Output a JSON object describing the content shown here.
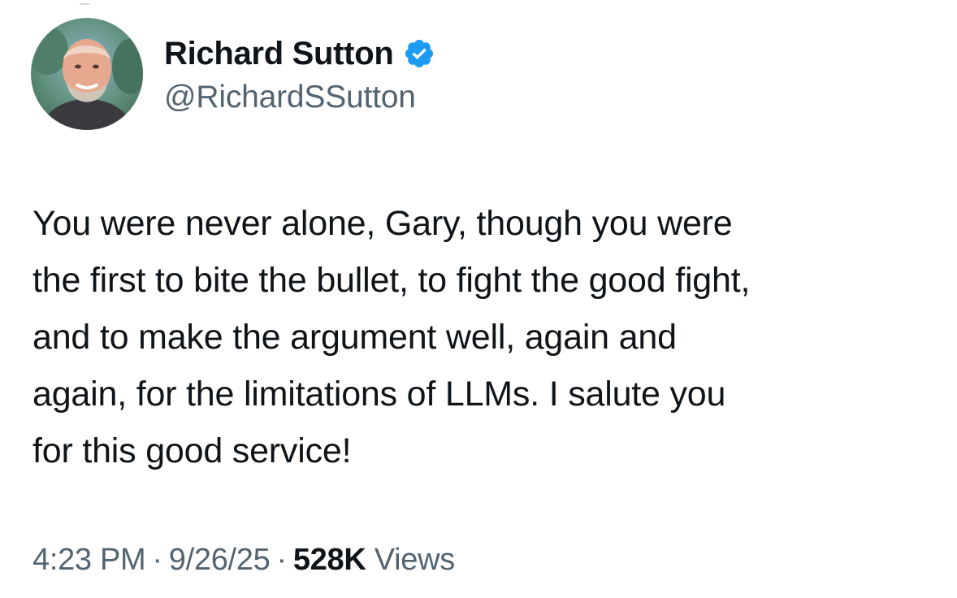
{
  "author": {
    "display_name": "Richard Sutton",
    "handle": "@RichardSSutton",
    "verified": true,
    "verified_color": "#1d9bf0",
    "avatar_icon": "profile-photo"
  },
  "tweet": {
    "lines": [
      "You were never alone, Gary, though you were",
      "the first to bite the bullet, to fight the good fight,",
      "and to make the argument well, again and",
      "again, for the limitations of LLMs. I salute you",
      "for this good service!"
    ]
  },
  "meta": {
    "time": "4:23 PM",
    "separator": "·",
    "date": "9/26/25",
    "views_count": "528K",
    "views_label": "Views"
  },
  "colors": {
    "text_primary": "#0f1419",
    "text_secondary": "#536471",
    "background": "#ffffff"
  }
}
